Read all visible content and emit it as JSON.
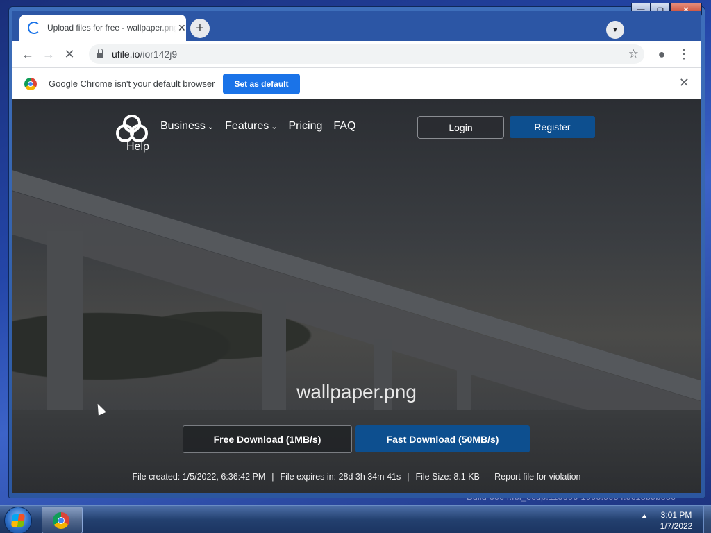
{
  "desktop": {
    "watermark": "Build 6004.fbl_ecup.110606-1000.9954.9c18b9be80"
  },
  "browser": {
    "tab": {
      "title": "Upload files for free - wallpaper.png - ufile.io"
    },
    "address": {
      "host": "ufile.io",
      "path": "/ior142j9"
    },
    "infobar": {
      "message": "Google Chrome isn't your default browser",
      "button": "Set as default"
    }
  },
  "site": {
    "nav": [
      "Business",
      "Features",
      "Pricing",
      "FAQ"
    ],
    "help": "Help",
    "login": "Login",
    "register": "Register",
    "filename": "wallpaper.png",
    "free_download": "Free Download (1MB/s)",
    "fast_download": "Fast Download (50MB/s)",
    "file_created": "File created: 1/5/2022, 6:36:42 PM",
    "file_expires": "File expires in: 28d 3h 34m 41s",
    "file_size": "File Size: 8.1 KB",
    "report": "Report file for violation"
  },
  "taskbar": {
    "time": "3:01 PM",
    "date": "1/7/2022"
  },
  "colors": {
    "accent_blue": "#1a73e8",
    "site_button_blue": "#0d4f8f"
  }
}
